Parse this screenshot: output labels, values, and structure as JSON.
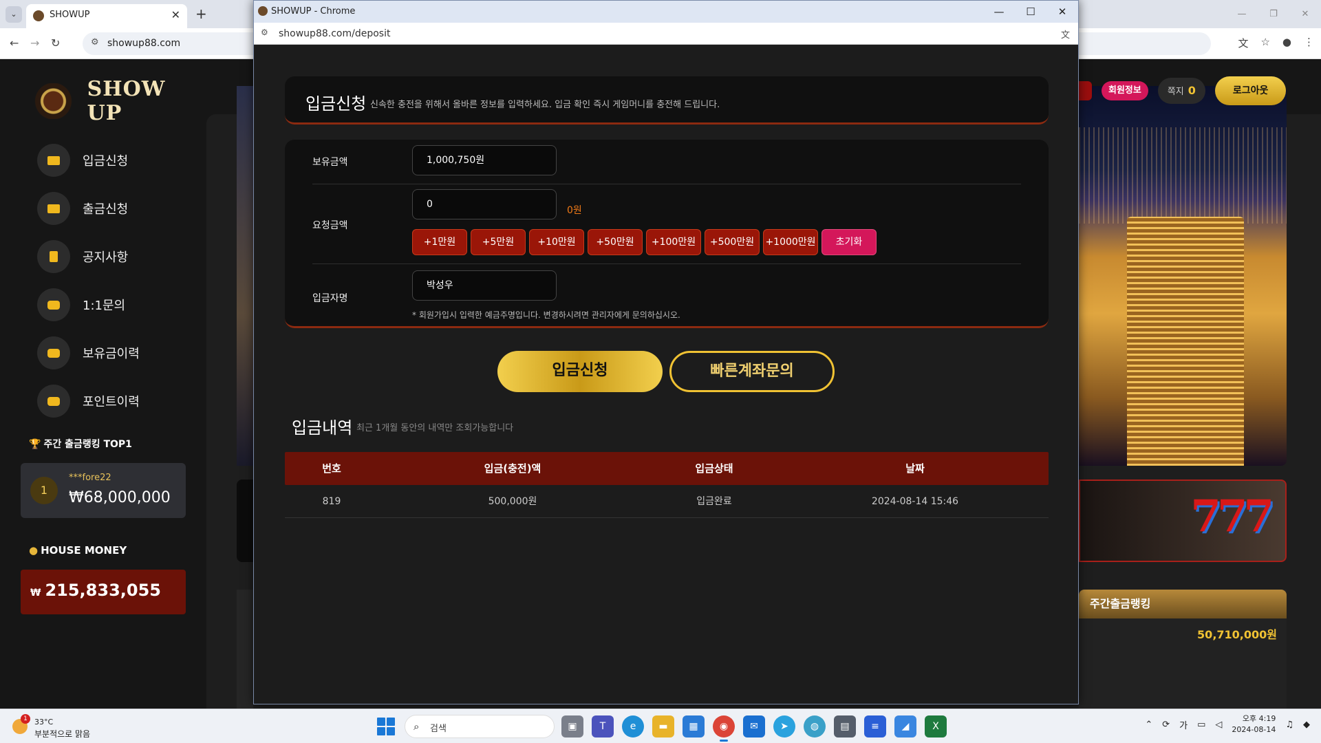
{
  "browser": {
    "tab_title": "SHOWUP",
    "url": "showup88.com"
  },
  "site": {
    "logo": "SHOW UP",
    "menu": [
      "입금신청",
      "출금신청",
      "공지사항",
      "1:1문의",
      "보유금이력",
      "포인트이력"
    ],
    "ranking_title": "주간 출금랭킹 TOP1",
    "ranking": {
      "rank": "1",
      "user": "***fore22",
      "amount": "₩68,000,000"
    },
    "house_title": "HOUSE MONEY",
    "house_currency": "₩",
    "house_amount": "215,833,055",
    "member_info": "회원정보",
    "messages_label": "쪽지",
    "messages_count": "0",
    "logout": "로그아웃",
    "weekly_title": "주간출금랭킹",
    "weekly_amount": "50,710,000원"
  },
  "popup": {
    "window_title": "SHOWUP - Chrome",
    "url": "showup88.com/deposit",
    "heading": "입금신청",
    "heading_sub": "신속한 충전을 위해서 올바른 정보를 입력하세요. 입금 확인 즉시 게임머니를 충전해 드립니다.",
    "balance_label": "보유금액",
    "balance_value": "1,000,750원",
    "request_label": "요청금액",
    "request_value": "0",
    "request_won": "0원",
    "amount_buttons": [
      "+1만원",
      "+5만원",
      "+10만원",
      "+50만원",
      "+100만원",
      "+500만원",
      "+1000만원"
    ],
    "reset_button": "초기화",
    "depositor_label": "입금자명",
    "depositor_value": "박성우",
    "depositor_note": "* 회원가입시 입력한 예금주명입니다. 변경하시려면 관리자에게 문의하십시오.",
    "submit_button": "입금신청",
    "quick_button": "빠른계좌문의",
    "history_heading": "입금내역",
    "history_sub": "최근 1개월 동안의 내역만 조회가능합니다",
    "table_headers": [
      "번호",
      "입금(충전)액",
      "입금상태",
      "날짜"
    ],
    "table_rows": [
      [
        "819",
        "500,000원",
        "입금완료",
        "2024-08-14 15:46"
      ]
    ]
  },
  "taskbar": {
    "temp": "33°C",
    "weather": "부분적으로 맑음",
    "weather_badge": "1",
    "search_placeholder": "검색",
    "time": "오후 4:19",
    "date": "2024-08-14",
    "ime": "가"
  },
  "colors": {
    "accent_gold": "#f0c233",
    "accent_red": "#6b1208",
    "accent_pink": "#d4175a"
  }
}
